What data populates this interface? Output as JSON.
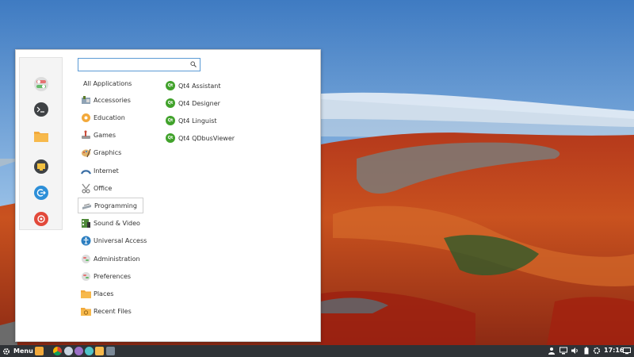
{
  "menu": {
    "search": {
      "value": "",
      "placeholder": ""
    },
    "categories_header": "All Applications",
    "categories": [
      {
        "label": "Accessories",
        "icon": "accessories-icon"
      },
      {
        "label": "Education",
        "icon": "education-icon"
      },
      {
        "label": "Games",
        "icon": "games-icon"
      },
      {
        "label": "Graphics",
        "icon": "graphics-icon"
      },
      {
        "label": "Internet",
        "icon": "internet-icon"
      },
      {
        "label": "Office",
        "icon": "office-icon"
      },
      {
        "label": "Programming",
        "icon": "programming-icon",
        "selected": true
      },
      {
        "label": "Sound & Video",
        "icon": "sound-video-icon"
      },
      {
        "label": "Universal Access",
        "icon": "universal-access-icon"
      },
      {
        "label": "Administration",
        "icon": "administration-icon"
      },
      {
        "label": "Preferences",
        "icon": "preferences-icon"
      },
      {
        "label": "Places",
        "icon": "places-folder-icon"
      },
      {
        "label": "Recent Files",
        "icon": "recent-files-icon"
      }
    ],
    "apps": [
      {
        "label": "Qt4 Assistant",
        "icon": "qt-icon"
      },
      {
        "label": "Qt4 Designer",
        "icon": "qt-icon"
      },
      {
        "label": "Qt4 Linguist",
        "icon": "qt-icon"
      },
      {
        "label": "Qt4 QDbusViewer",
        "icon": "qt-icon"
      }
    ],
    "qt_icon_text": "Qt",
    "favorites": [
      "settings-toggle-icon",
      "terminal-icon",
      "folder-icon",
      "screen-lock-icon",
      "logout-icon",
      "shutdown-icon"
    ]
  },
  "taskbar": {
    "menu_label": "Menu",
    "clock": "17:16",
    "launchers": [
      "home-folder-icon",
      "chrome-icon",
      "browser-icon",
      "app-icon",
      "software-icon",
      "files-icon",
      "app-icon-2"
    ],
    "tray": [
      "user-icon",
      "network-icon",
      "volume-icon",
      "battery-icon",
      "settings-icon",
      "display-icon"
    ]
  },
  "colors": {
    "accent": "#5b9bd5",
    "qt_green": "#41a22b",
    "taskbar_bg": "#2f3337"
  }
}
